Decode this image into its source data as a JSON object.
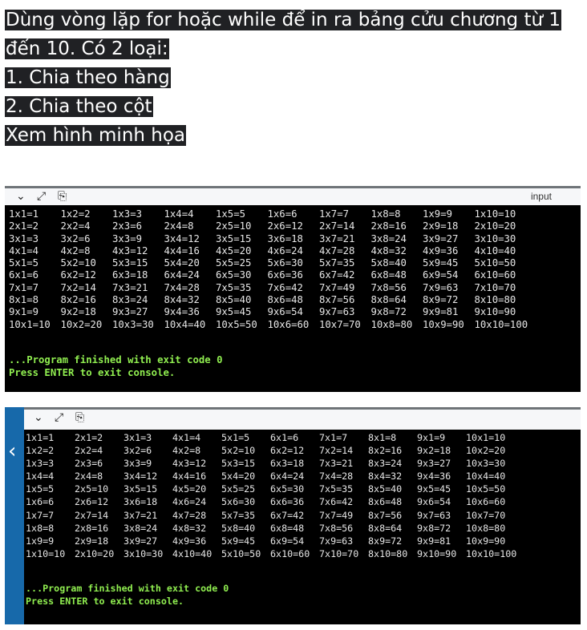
{
  "prompt": {
    "lines": [
      "Dùng vòng lặp for hoặc while để in ra bảng cửu chương từ 1",
      "đến 10. Có 2 loại:",
      "1. Chia theo hàng",
      "2. Chia theo cột",
      "Xem hình minh họa"
    ]
  },
  "console1": {
    "toolbar": {
      "collapse_icon": "chevron-down-icon",
      "expand_icon": "expand-icon",
      "copy_icon": "clipboard-icon",
      "label": "input"
    },
    "rows": [
      [
        "1x1=1",
        "1x2=2",
        "1x3=3",
        "1x4=4",
        "1x5=5",
        "1x6=6",
        "1x7=7",
        "1x8=8",
        "1x9=9",
        "1x10=10"
      ],
      [
        "2x1=2",
        "2x2=4",
        "2x3=6",
        "2x4=8",
        "2x5=10",
        "2x6=12",
        "2x7=14",
        "2x8=16",
        "2x9=18",
        "2x10=20"
      ],
      [
        "3x1=3",
        "3x2=6",
        "3x3=9",
        "3x4=12",
        "3x5=15",
        "3x6=18",
        "3x7=21",
        "3x8=24",
        "3x9=27",
        "3x10=30"
      ],
      [
        "4x1=4",
        "4x2=8",
        "4x3=12",
        "4x4=16",
        "4x5=20",
        "4x6=24",
        "4x7=28",
        "4x8=32",
        "4x9=36",
        "4x10=40"
      ],
      [
        "5x1=5",
        "5x2=10",
        "5x3=15",
        "5x4=20",
        "5x5=25",
        "5x6=30",
        "5x7=35",
        "5x8=40",
        "5x9=45",
        "5x10=50"
      ],
      [
        "6x1=6",
        "6x2=12",
        "6x3=18",
        "6x4=24",
        "6x5=30",
        "6x6=36",
        "6x7=42",
        "6x8=48",
        "6x9=54",
        "6x10=60"
      ],
      [
        "7x1=7",
        "7x2=14",
        "7x3=21",
        "7x4=28",
        "7x5=35",
        "7x6=42",
        "7x7=49",
        "7x8=56",
        "7x9=63",
        "7x10=70"
      ],
      [
        "8x1=8",
        "8x2=16",
        "8x3=24",
        "8x4=32",
        "8x5=40",
        "8x6=48",
        "8x7=56",
        "8x8=64",
        "8x9=72",
        "8x10=80"
      ],
      [
        "9x1=9",
        "9x2=18",
        "9x3=27",
        "9x4=36",
        "9x5=45",
        "9x6=54",
        "9x7=63",
        "9x8=72",
        "9x9=81",
        "9x10=90"
      ],
      [
        "10x1=10",
        "10x2=20",
        "10x3=30",
        "10x4=40",
        "10x5=50",
        "10x6=60",
        "10x7=70",
        "10x8=80",
        "10x9=90",
        "10x10=100"
      ]
    ],
    "status_line1": "...Program finished with exit code 0",
    "status_line2": "Press ENTER to exit console."
  },
  "console2": {
    "toolbar": {
      "collapse_icon": "chevron-down-icon",
      "expand_icon": "expand-icon",
      "copy_icon": "clipboard-icon"
    },
    "side_arrow": "‹",
    "rows": [
      [
        "1x1=1",
        "2x1=2",
        "3x1=3",
        "4x1=4",
        "5x1=5",
        "6x1=6",
        "7x1=7",
        "8x1=8",
        "9x1=9",
        "10x1=10"
      ],
      [
        "1x2=2",
        "2x2=4",
        "3x2=6",
        "4x2=8",
        "5x2=10",
        "6x2=12",
        "7x2=14",
        "8x2=16",
        "9x2=18",
        "10x2=20"
      ],
      [
        "1x3=3",
        "2x3=6",
        "3x3=9",
        "4x3=12",
        "5x3=15",
        "6x3=18",
        "7x3=21",
        "8x3=24",
        "9x3=27",
        "10x3=30"
      ],
      [
        "1x4=4",
        "2x4=8",
        "3x4=12",
        "4x4=16",
        "5x4=20",
        "6x4=24",
        "7x4=28",
        "8x4=32",
        "9x4=36",
        "10x4=40"
      ],
      [
        "1x5=5",
        "2x5=10",
        "3x5=15",
        "4x5=20",
        "5x5=25",
        "6x5=30",
        "7x5=35",
        "8x5=40",
        "9x5=45",
        "10x5=50"
      ],
      [
        "1x6=6",
        "2x6=12",
        "3x6=18",
        "4x6=24",
        "5x6=30",
        "6x6=36",
        "7x6=42",
        "8x6=48",
        "9x6=54",
        "10x6=60"
      ],
      [
        "1x7=7",
        "2x7=14",
        "3x7=21",
        "4x7=28",
        "5x7=35",
        "6x7=42",
        "7x7=49",
        "8x7=56",
        "9x7=63",
        "10x7=70"
      ],
      [
        "1x8=8",
        "2x8=16",
        "3x8=24",
        "4x8=32",
        "5x8=40",
        "6x8=48",
        "7x8=56",
        "8x8=64",
        "9x8=72",
        "10x8=80"
      ],
      [
        "1x9=9",
        "2x9=18",
        "3x9=27",
        "4x9=36",
        "5x9=45",
        "6x9=54",
        "7x9=63",
        "8x9=72",
        "9x9=81",
        "10x9=90"
      ],
      [
        "1x10=10",
        "2x10=20",
        "3x10=30",
        "4x10=40",
        "5x10=50",
        "6x10=60",
        "7x10=70",
        "8x10=80",
        "9x10=90",
        "10x10=100"
      ]
    ],
    "status_line1": "...Program finished with exit code 0",
    "status_line2": "Press ENTER to exit console."
  }
}
